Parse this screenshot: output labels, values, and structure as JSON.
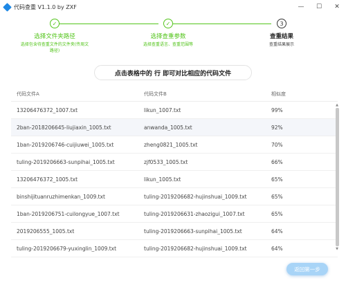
{
  "window": {
    "title": "代码查重 V1.1.0 by ZXF",
    "controls": [
      "—",
      "☐",
      "✕"
    ]
  },
  "steps": [
    {
      "title": "选择文件夹路径",
      "desc_line1": "选择包含待查重文件的文件夹(传周文",
      "desc_line2": "路径)",
      "marker": "✓",
      "status": "done"
    },
    {
      "title": "选择查重参数",
      "desc_line1": "选择查重语言、查重范围等",
      "marker": "✓",
      "status": "done"
    },
    {
      "title": "查重结果",
      "desc_line1": "查重结果展示",
      "marker": "3",
      "status": "active"
    }
  ],
  "hint": "点击表格中的 行 即可对比相应的代码文件",
  "table": {
    "headers": [
      "代码文件A",
      "代码文件B",
      "相似度"
    ],
    "rows": [
      [
        "13206476372_1007.txt",
        "likun_1007.txt",
        "99%"
      ],
      [
        "2ban-2018206645-liujiaxin_1005.txt",
        "anwanda_1005.txt",
        "92%"
      ],
      [
        "1ban-2019206746-cuijiuwei_1005.txt",
        "zheng0821_1005.txt",
        "70%"
      ],
      [
        "tuling-2019206663-sunpihai_1005.txt",
        "zjf0533_1005.txt",
        "66%"
      ],
      [
        "13206476372_1005.txt",
        "likun_1005.txt",
        "65%"
      ],
      [
        "binshijituanruzhimenkan_1009.txt",
        "tuling-2019206682-hujinshuai_1009.txt",
        "65%"
      ],
      [
        "1ban-2019206751-cuilongyue_1007.txt",
        "tuling-2019206631-zhaozigui_1007.txt",
        "65%"
      ],
      [
        "2019206555_1005.txt",
        "tuling-2019206663-sunpihai_1005.txt",
        "64%"
      ],
      [
        "tuling-2019206679-yuxinglin_1009.txt",
        "tuling-2019206682-hujinshuai_1009.txt",
        "64%"
      ]
    ]
  },
  "back_button": "返回第一步",
  "colors": {
    "done": "#52c41a",
    "button": "#a8d4f7",
    "row_alt": "#f4f6fa"
  }
}
